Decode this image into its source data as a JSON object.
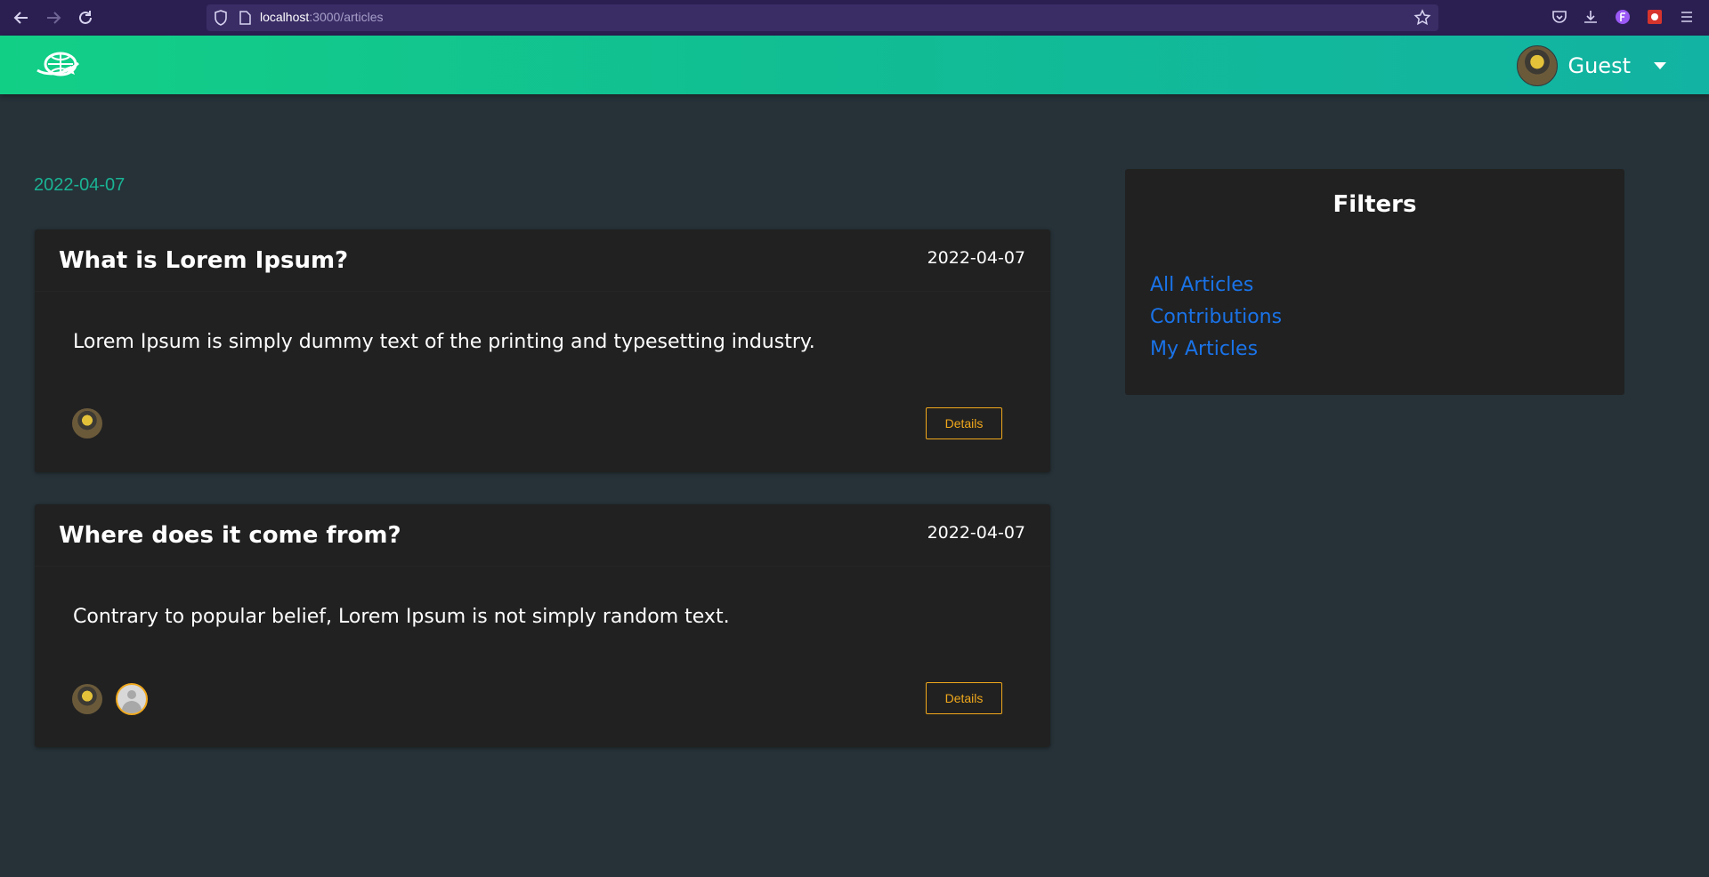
{
  "browser": {
    "url_host": "localhost",
    "url_path": ":3000/articles"
  },
  "header": {
    "user_name": "Guest"
  },
  "group_date": "2022-04-07",
  "articles": [
    {
      "title": "What is Lorem Ipsum?",
      "date": "2022-04-07",
      "summary": "Lorem Ipsum is simply dummy text of the printing and typesetting industry.",
      "details_label": "Details"
    },
    {
      "title": "Where does it come from?",
      "date": "2022-04-07",
      "summary": "Contrary to popular belief, Lorem Ipsum is not simply random text.",
      "details_label": "Details"
    }
  ],
  "filters": {
    "title": "Filters",
    "links": [
      "All Articles",
      "Contributions",
      "My Articles"
    ]
  },
  "colors": {
    "accent": "#1ab394",
    "header_start": "#12cf86",
    "header_end": "#12b3a2",
    "button": "#f0a81c",
    "link": "#1a73e8",
    "card": "#212121",
    "background": "#263238"
  }
}
